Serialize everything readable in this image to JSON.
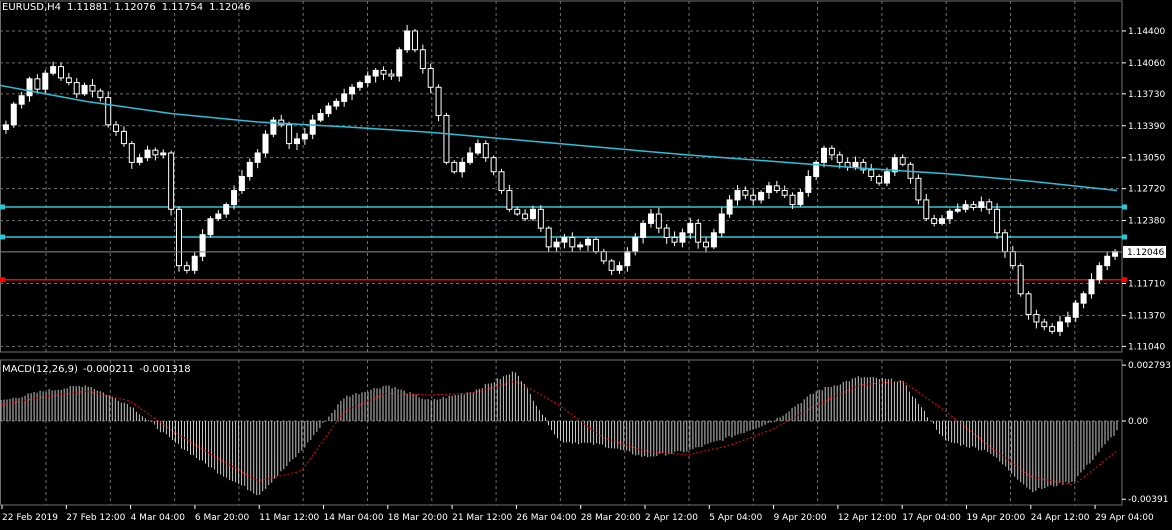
{
  "window": {
    "symbol": "EURUSD,H4",
    "ohlc": [
      "1.11881",
      "1.12076",
      "1.11754",
      "1.12046"
    ]
  },
  "colors": {
    "background": "#000000",
    "grid": "#6f6f6f",
    "candle_bull": "#ffffff",
    "candle_bear": "#000000",
    "moving_average": "#29c0d8",
    "support_lines": "#29c8d8",
    "red_line": "#ff0000",
    "macd_bars": "#c8c8c8",
    "macd_signal": "#ff0000",
    "price_tag_bg": "#ffffff",
    "price_tag_text": "#000000"
  },
  "chart_data": [
    {
      "type": "candlestick",
      "title": "",
      "ylim": [
        1.1098,
        1.1457
      ],
      "y_ticks": [
        "1.14400",
        "1.14060",
        "1.13730",
        "1.13390",
        "1.13050",
        "1.12720",
        "1.12380",
        "1.12046",
        "1.11710",
        "1.11370",
        "1.11040"
      ],
      "y_tick_values": [
        1.144,
        1.1406,
        1.1373,
        1.1339,
        1.1305,
        1.1272,
        1.1238,
        1.12046,
        1.1171,
        1.1137,
        1.1104
      ],
      "current_price": "1.12046",
      "x_ticks": [
        "22 Feb 2019",
        "27 Feb 12:00",
        "4 Mar 04:00",
        "6 Mar 20:00",
        "11 Mar 12:00",
        "14 Mar 04:00",
        "18 Mar 20:00",
        "21 Mar 12:00",
        "26 Mar 04:00",
        "28 Mar 20:00",
        "2 Apr 12:00",
        "5 Apr 04:00",
        "9 Apr 20:00",
        "12 Apr 12:00",
        "17 Apr 04:00",
        "19 Apr 20:00",
        "24 Apr 12:00",
        "29 Apr 04:00"
      ],
      "horizontal_lines": [
        {
          "price": 1.12525,
          "color": "#29c8d8"
        },
        {
          "price": 1.12205,
          "color": "#29c8d8"
        },
        {
          "price": 1.1175,
          "color": "#ff0000"
        }
      ],
      "moving_average": [
        1.1382,
        1.1365,
        1.1352,
        1.1343,
        1.1338,
        1.1332,
        1.1324,
        1.1316,
        1.1308,
        1.1301,
        1.1294,
        1.1288,
        1.128,
        1.127
      ],
      "closes": [
        1.134,
        1.1362,
        1.1371,
        1.1389,
        1.1378,
        1.1395,
        1.1402,
        1.139,
        1.1385,
        1.1373,
        1.1382,
        1.1376,
        1.1369,
        1.134,
        1.1333,
        1.132,
        1.13,
        1.1305,
        1.1313,
        1.1308,
        1.131,
        1.125,
        1.119,
        1.1185,
        1.12,
        1.1223,
        1.124,
        1.1245,
        1.1255,
        1.127,
        1.1285,
        1.13,
        1.131,
        1.133,
        1.1345,
        1.134,
        1.132,
        1.1325,
        1.133,
        1.1345,
        1.1352,
        1.136,
        1.1365,
        1.1373,
        1.138,
        1.1385,
        1.1392,
        1.1398,
        1.1394,
        1.1392,
        1.142,
        1.144,
        1.142,
        1.14,
        1.138,
        1.135,
        1.13,
        1.129,
        1.13,
        1.131,
        1.132,
        1.1305,
        1.129,
        1.127,
        1.125,
        1.1245,
        1.124,
        1.125,
        1.123,
        1.121,
        1.1215,
        1.122,
        1.121,
        1.1212,
        1.1218,
        1.1205,
        1.1195,
        1.1185,
        1.119,
        1.1205,
        1.122,
        1.1235,
        1.1245,
        1.123,
        1.122,
        1.1215,
        1.1225,
        1.1235,
        1.1215,
        1.121,
        1.1225,
        1.1245,
        1.126,
        1.127,
        1.1265,
        1.126,
        1.1268,
        1.1275,
        1.127,
        1.1265,
        1.1255,
        1.1268,
        1.1285,
        1.13,
        1.1315,
        1.1308,
        1.13,
        1.1295,
        1.13,
        1.1292,
        1.1285,
        1.1278,
        1.129,
        1.1305,
        1.1298,
        1.1283,
        1.126,
        1.124,
        1.1235,
        1.124,
        1.1248,
        1.125,
        1.1255,
        1.1252,
        1.1258,
        1.125,
        1.1225,
        1.1205,
        1.119,
        1.116,
        1.1138,
        1.113,
        1.1125,
        1.112,
        1.113,
        1.1135,
        1.115,
        1.116,
        1.1175,
        1.119,
        1.12,
        1.1205
      ]
    },
    {
      "type": "bar",
      "title": "MACD",
      "label": "MACD(12,26,9)",
      "values_text": [
        "-0.000211",
        "-0.001318"
      ],
      "ylim": [
        -0.0042,
        0.00305
      ],
      "y_ticks": [
        "0.002793",
        "0.00",
        "-0.00391"
      ],
      "y_tick_values": [
        0.002793,
        0.0,
        -0.00391
      ],
      "macd_anchors": [
        0.001,
        0.0015,
        0.0018,
        0.0008,
        -0.001,
        -0.0025,
        -0.0037,
        -0.0015,
        0.0012,
        0.0018,
        0.001,
        0.0015,
        0.0025,
        -0.001,
        -0.0012,
        -0.0018,
        -0.0015,
        -0.0008,
        0.0,
        0.0015,
        0.0022,
        0.002,
        -0.001,
        -0.0015,
        -0.0035,
        -0.003,
        -0.0005
      ],
      "signal_anchors": [
        0.0008,
        0.0012,
        0.0015,
        0.001,
        -0.0005,
        -0.0018,
        -0.003,
        -0.0025,
        0.0005,
        0.0014,
        0.0013,
        0.0014,
        0.002,
        0.0008,
        -0.0008,
        -0.0015,
        -0.0017,
        -0.0012,
        -0.0004,
        0.0008,
        0.0018,
        0.002,
        0.0005,
        -0.0012,
        -0.0028,
        -0.0032,
        -0.0015
      ]
    }
  ]
}
